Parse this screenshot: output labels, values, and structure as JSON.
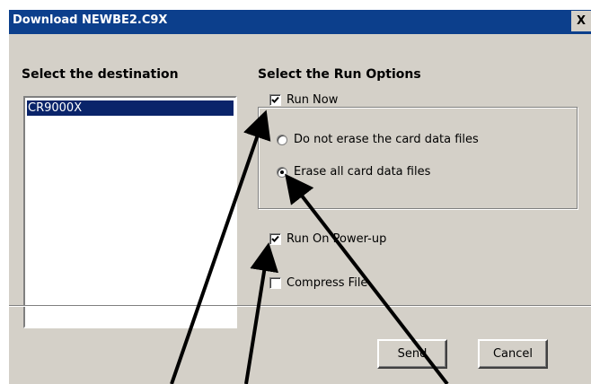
{
  "window": {
    "title": "Download NEWBE2.C9X",
    "close_label": "X"
  },
  "destination": {
    "heading": "Select the destination",
    "items": [
      {
        "label": "CR9000X",
        "selected": true
      }
    ]
  },
  "run_options": {
    "heading": "Select the Run Options",
    "run_now": {
      "label": "Run Now",
      "checked": true
    },
    "erase_options": [
      {
        "label": "Do not erase the card data files",
        "selected": false
      },
      {
        "label": "Erase all card data files",
        "selected": true
      }
    ],
    "run_on_powerup": {
      "label": "Run On Power-up",
      "checked": true
    },
    "compress_file": {
      "label": "Compress File",
      "checked": false
    }
  },
  "buttons": {
    "send": "Send",
    "cancel": "Cancel"
  },
  "colors": {
    "titlebar": "#0c3f8c",
    "dialog": "#d4d0c8",
    "selection": "#0a246a"
  }
}
